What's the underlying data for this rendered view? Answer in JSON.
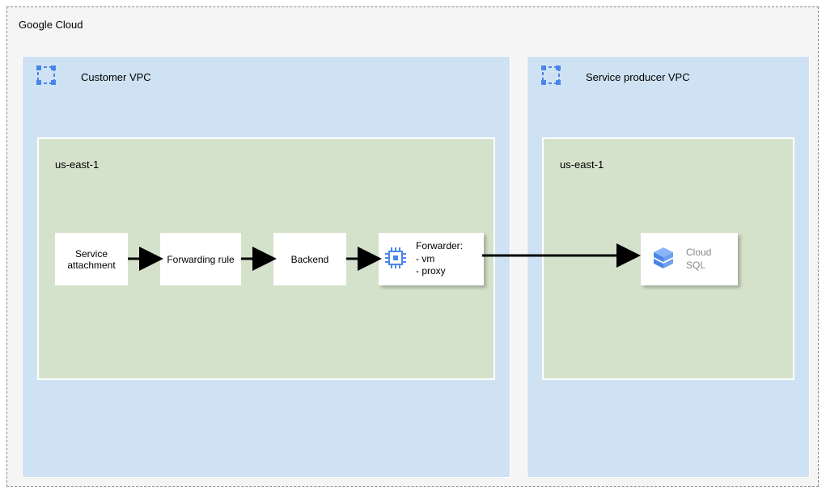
{
  "outer": {
    "title": "Google Cloud"
  },
  "vpc_left": {
    "title": "Customer VPC",
    "region": "us-east-1"
  },
  "vpc_right": {
    "title": "Service producer VPC",
    "region": "us-east-1"
  },
  "nodes": {
    "service_attachment": "Service\nattachment",
    "forwarding_rule": "Forwarding rule",
    "backend": "Backend",
    "forwarder": "Forwarder:\n- vm\n- proxy",
    "cloud_sql": "Cloud\nSQL"
  }
}
